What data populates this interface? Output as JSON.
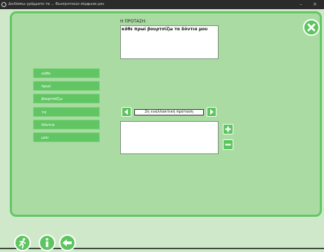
{
  "window": {
    "title": "Διεδόσκω γράμματο τα ... Φωνηεντικών σύμφωνα μου",
    "minimize_glyph": "–",
    "close_glyph": "×"
  },
  "sentence": {
    "label": "Η ΠΡΟΤΑΣΗ:",
    "text": "κάθε πρωί βουρτσίζω τα δόντια μου"
  },
  "word_tiles": [
    "κάθε",
    "πρωί",
    "βουρτσίζω",
    "τα",
    "δόντια",
    "μου"
  ],
  "alternative": {
    "label": "2η εναλλακτική πρόταση",
    "prev_icon": "arrow-left-icon",
    "next_icon": "arrow-right-icon"
  },
  "answer": {
    "value": ""
  },
  "icons": {
    "close": "close-x-icon",
    "add": "plus-icon",
    "remove": "minus-icon",
    "exit": "running-man-icon",
    "info": "info-icon",
    "back": "back-arrow-icon"
  },
  "colors": {
    "panel_bg": "#a9dba2",
    "panel_border": "#63c765",
    "button_green": "#5dc55f",
    "page_bg": "#cfe8c9"
  }
}
